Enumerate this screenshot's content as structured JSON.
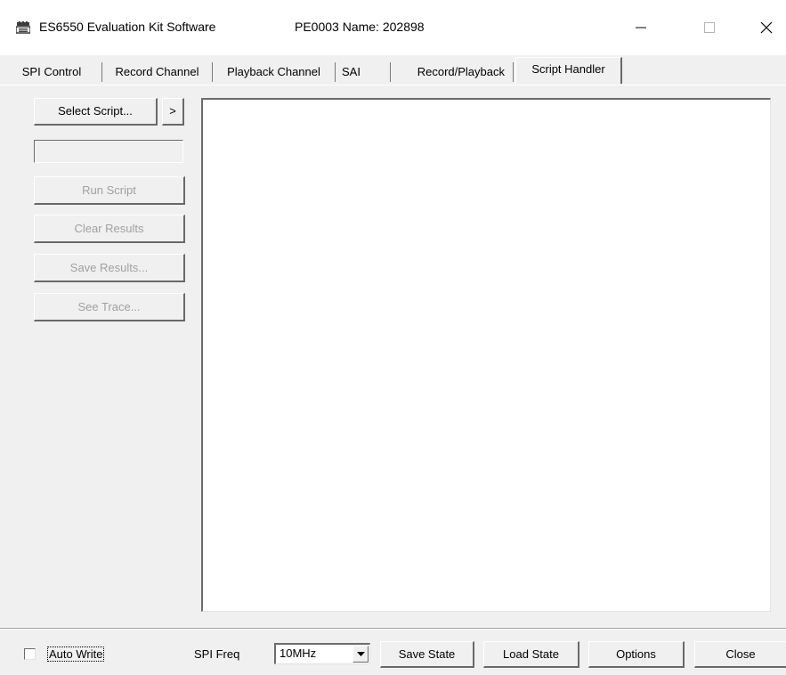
{
  "window": {
    "title": "ES6550 Evaluation Kit Software",
    "subtitle": "PE0003 Name: 202898",
    "controls": {
      "minimize_glyph": "—",
      "maximize_glyph": "☐",
      "close_glyph": "✕"
    },
    "icon": "app-icon"
  },
  "tabs": [
    {
      "label": "SPI Control",
      "active": false
    },
    {
      "label": "Record Channel",
      "active": false
    },
    {
      "label": "Playback Channel",
      "active": false
    },
    {
      "label": "SAI",
      "active": false
    },
    {
      "label": "Record/Playback",
      "active": false
    },
    {
      "label": "Script Handler",
      "active": true
    }
  ],
  "script_handler": {
    "select_script_label": "Select Script...",
    "next_label": ">",
    "script_path_value": "",
    "run_script_label": "Run Script",
    "clear_results_label": "Clear Results",
    "save_results_label": "Save Results...",
    "see_trace_label": "See Trace...",
    "results_text": ""
  },
  "bottom_bar": {
    "auto_write_label": "Auto Write",
    "auto_write_checked": false,
    "spi_freq_label": "SPI Freq",
    "spi_freq_value": "10MHz",
    "save_state_label": "Save State",
    "load_state_label": "Load State",
    "options_label": "Options",
    "close_label": "Close"
  },
  "colors": {
    "face": "#f0f0f0",
    "shadow": "#696969",
    "highlight": "#ffffff",
    "disabled_text": "#a0a0a0"
  }
}
